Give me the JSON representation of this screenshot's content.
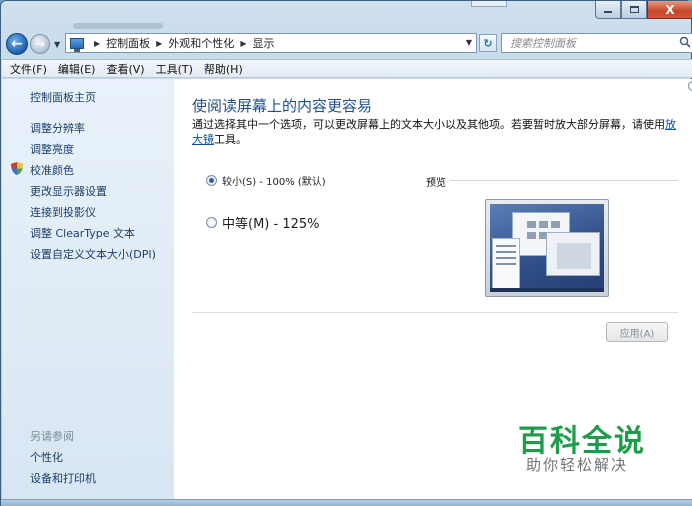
{
  "window": {
    "controls": {
      "close_label": "X"
    }
  },
  "address": {
    "breadcrumbs": [
      "控制面板",
      "外观和个性化",
      "显示"
    ],
    "search_placeholder": "搜索控制面板"
  },
  "menu": [
    "文件(F)",
    "编辑(E)",
    "查看(V)",
    "工具(T)",
    "帮助(H)"
  ],
  "sidebar": {
    "home": "控制面板主页",
    "links": [
      "调整分辨率",
      "调整亮度",
      "校准颜色",
      "更改显示器设置",
      "连接到投影仪",
      "调整 ClearType 文本",
      "设置自定义文本大小(DPI)"
    ],
    "see_also_label": "另请参阅",
    "see_also": [
      "个性化",
      "设备和打印机"
    ]
  },
  "main": {
    "title": "使阅读屏幕上的内容更容易",
    "description": "通过选择其中一个选项，可以更改屏幕上的文本大小以及其他项。若要暂时放大部分屏幕，请使用",
    "magnifier_link": "放大镜",
    "description_end": "工具。",
    "options": [
      {
        "label": "较小(S) - 100% (默认)",
        "checked": true
      },
      {
        "label": "中等(M) - 125%",
        "checked": false
      }
    ],
    "preview_label": "预览",
    "apply_label": "应用(A)"
  },
  "watermark": {
    "title": "百科全说",
    "subtitle": "助你轻松解决"
  },
  "colors": {
    "accent_link": "#1b3f6a",
    "title_blue": "#1d4f91",
    "watermark_green": "#1f9c4a",
    "close_red": "#c7452a"
  }
}
